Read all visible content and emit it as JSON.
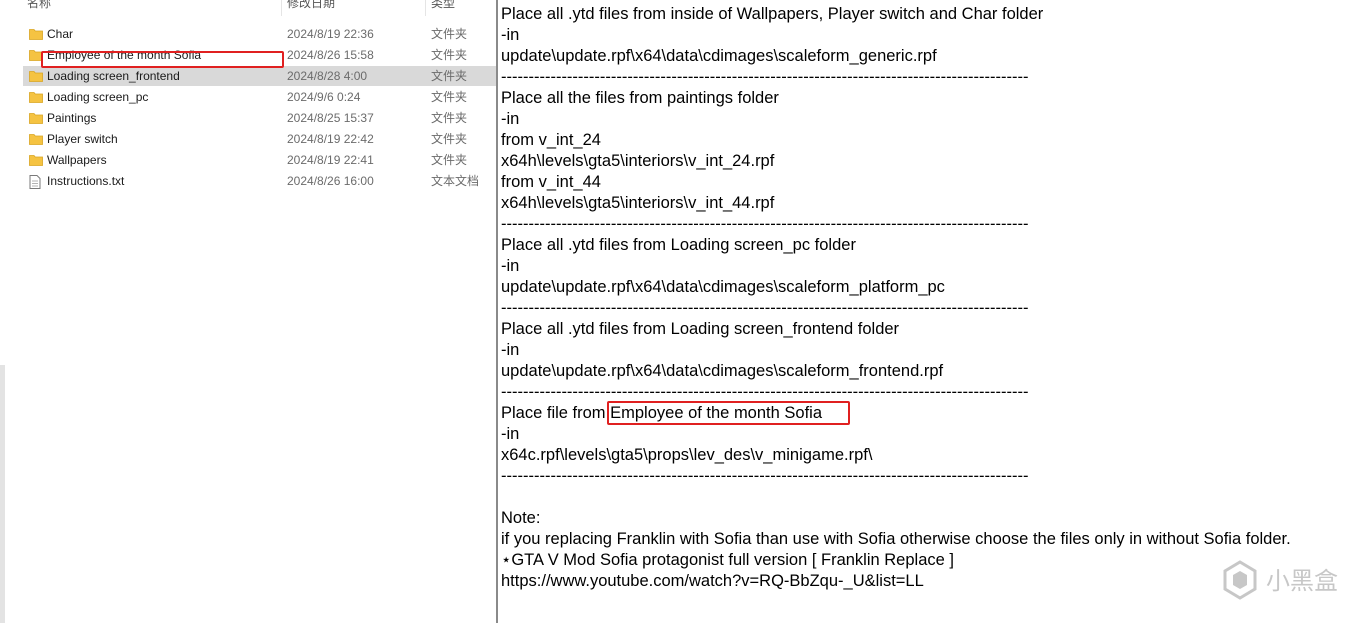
{
  "explorer": {
    "columns": {
      "name": "名称",
      "date": "修改日期",
      "type": "类型"
    },
    "files": [
      {
        "name": "Char",
        "date": "2024/8/19 22:36",
        "type": "文件夹",
        "kind": "folder",
        "selected": false
      },
      {
        "name": "Employee of the month Sofia",
        "date": "2024/8/26 15:58",
        "type": "文件夹",
        "kind": "folder",
        "selected": false
      },
      {
        "name": "Loading screen_frontend",
        "date": "2024/8/28 4:00",
        "type": "文件夹",
        "kind": "folder",
        "selected": true
      },
      {
        "name": "Loading screen_pc",
        "date": "2024/9/6 0:24",
        "type": "文件夹",
        "kind": "folder",
        "selected": false
      },
      {
        "name": "Paintings",
        "date": "2024/8/25 15:37",
        "type": "文件夹",
        "kind": "folder",
        "selected": false
      },
      {
        "name": "Player switch",
        "date": "2024/8/19 22:42",
        "type": "文件夹",
        "kind": "folder",
        "selected": false
      },
      {
        "name": "Wallpapers",
        "date": "2024/8/19 22:41",
        "type": "文件夹",
        "kind": "folder",
        "selected": false
      },
      {
        "name": "Instructions.txt",
        "date": "2024/8/26 16:00",
        "type": "文本文档",
        "kind": "text",
        "selected": false
      }
    ]
  },
  "notepad": {
    "lines": [
      "Place all .ytd files from inside of Wallpapers, Player switch and Char folder",
      "-in",
      "update\\update.rpf\\x64\\data\\cdimages\\scaleform_generic.rpf",
      "------------------------------------------------------------------------------------------------",
      "Place all the files from paintings folder",
      "-in",
      "from v_int_24",
      "x64h\\levels\\gta5\\interiors\\v_int_24.rpf",
      "from v_int_44",
      "x64h\\levels\\gta5\\interiors\\v_int_44.rpf",
      "------------------------------------------------------------------------------------------------",
      "Place all .ytd files from Loading screen_pc folder",
      "-in",
      "update\\update.rpf\\x64\\data\\cdimages\\scaleform_platform_pc",
      "------------------------------------------------------------------------------------------------",
      "Place all .ytd files from Loading screen_frontend folder",
      "-in",
      "update\\update.rpf\\x64\\data\\cdimages\\scaleform_frontend.rpf",
      "------------------------------------------------------------------------------------------------",
      "Place file from  Employee of the month Sofia",
      "-in",
      "x64c.rpf\\levels\\gta5\\props\\lev_des\\v_minigame.rpf\\",
      "------------------------------------------------------------------------------------------------",
      "",
      "Note:",
      "if you replacing Franklin with Sofia than use with Sofia otherwise choose the files only in without Sofia folder.",
      "⋆GTA V Mod Sofia protagonist full version [ Franklin Replace ]",
      "https://www.youtube.com/watch?v=RQ-BbZqu-_U&list=LL"
    ]
  },
  "watermark": {
    "text": "小黑盒"
  },
  "colors": {
    "highlight": "#e02020",
    "selected_row": "#d9d9d9",
    "folder": "#f5c342"
  }
}
